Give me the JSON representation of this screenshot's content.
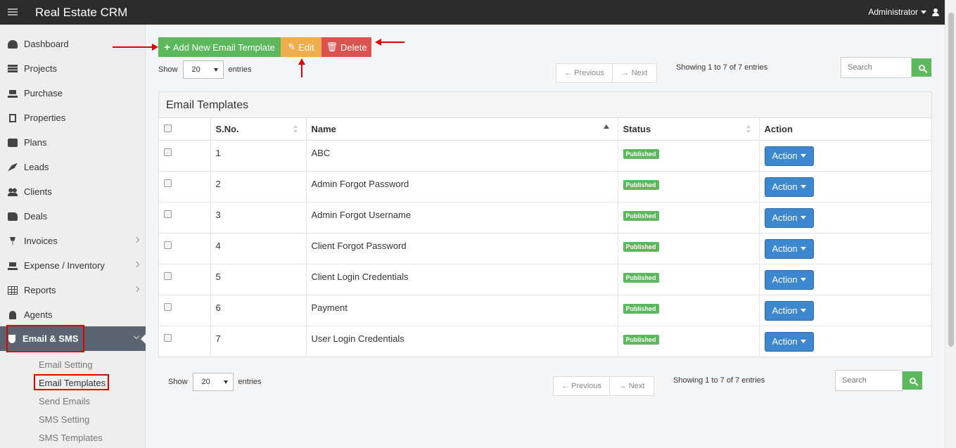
{
  "app": {
    "title": "Real Estate CRM",
    "user": "Administrator"
  },
  "sidebar": {
    "items": [
      {
        "label": "Dashboard",
        "icon": "dashboard-icon"
      },
      {
        "label": "Projects",
        "icon": "list-icon"
      },
      {
        "label": "Purchase",
        "icon": "cart-icon"
      },
      {
        "label": "Properties",
        "icon": "building-icon"
      },
      {
        "label": "Plans",
        "icon": "briefcase-icon"
      },
      {
        "label": "Leads",
        "icon": "rocket-icon"
      },
      {
        "label": "Clients",
        "icon": "users-icon"
      },
      {
        "label": "Deals",
        "icon": "thumbs-up-icon"
      },
      {
        "label": "Invoices",
        "icon": "pin-icon"
      },
      {
        "label": "Expense / Inventory",
        "icon": "cart-icon"
      },
      {
        "label": "Reports",
        "icon": "table-icon"
      },
      {
        "label": "Agents",
        "icon": "agent-icon"
      },
      {
        "label": "Email & SMS",
        "icon": "shield-icon"
      }
    ],
    "subitems": [
      {
        "label": "Email Setting"
      },
      {
        "label": "Email Templates"
      },
      {
        "label": "Send Emails"
      },
      {
        "label": "SMS Setting"
      },
      {
        "label": "SMS Templates"
      }
    ]
  },
  "toolbar": {
    "add_label": "Add New Email Template",
    "edit_label": "Edit",
    "delete_label": "Delete"
  },
  "pagination": {
    "show_label": "Show",
    "entries_label": "entries",
    "page_size": "20",
    "prev_label": "← Previous",
    "next_label": "→ Next",
    "showing_text": "Showing 1 to 7 of 7 entries",
    "search_placeholder": "Search"
  },
  "panel": {
    "title": "Email Templates",
    "columns": [
      "S.No.",
      "Name",
      "Status",
      "Action"
    ],
    "rows": [
      {
        "sno": "1",
        "name": "ABC",
        "status": "Published",
        "action": "Action"
      },
      {
        "sno": "2",
        "name": "Admin Forgot Password",
        "status": "Published",
        "action": "Action"
      },
      {
        "sno": "3",
        "name": "Admin Forgot Username",
        "status": "Published",
        "action": "Action"
      },
      {
        "sno": "4",
        "name": "Client Forgot Password",
        "status": "Published",
        "action": "Action"
      },
      {
        "sno": "5",
        "name": "Client Login Credentials",
        "status": "Published",
        "action": "Action"
      },
      {
        "sno": "6",
        "name": "Payment",
        "status": "Published",
        "action": "Action"
      },
      {
        "sno": "7",
        "name": "User Login Credentials",
        "status": "Published",
        "action": "Action"
      }
    ]
  },
  "colors": {
    "topbar": "#2c2c2c",
    "sidebar_active": "#5b6571",
    "green": "#5cb85c",
    "orange": "#f0ad4e",
    "red": "#d9534f",
    "blue": "#3d87cf",
    "annotation": "#e00000"
  }
}
